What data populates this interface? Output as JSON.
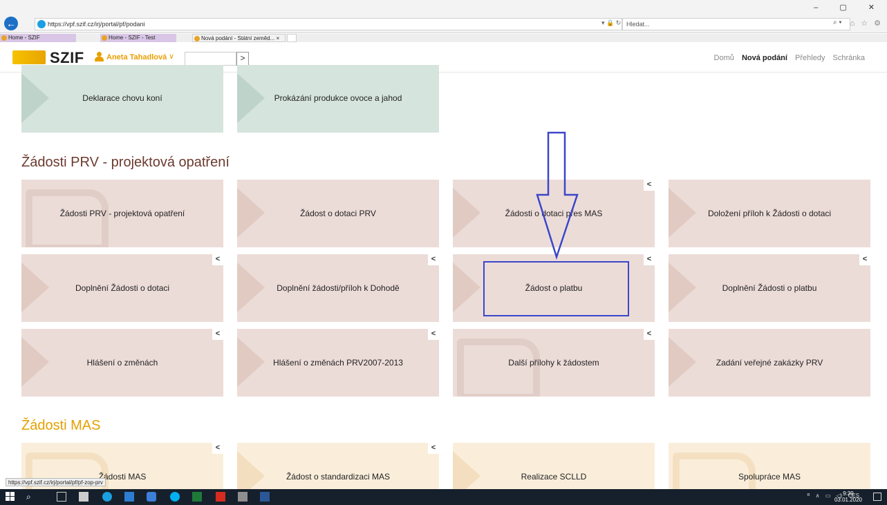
{
  "browser": {
    "url": "https://vpf.szif.cz/irj/portal/pf/podani",
    "search_placeholder": "Hledat...",
    "tabs": [
      {
        "label": "Home - SZIF"
      },
      {
        "label": "Home - SZIF - Test"
      },
      {
        "label": "Nová podání - Státní zeměd... ×"
      },
      {
        "label": ""
      }
    ],
    "status_url": "https://vpf.szif.cz/irj/portal/pf/pf-zop-prv"
  },
  "header": {
    "logo": "SZIF",
    "user_name": "Aneta Tahadlová",
    "user_caret": "∨",
    "search_btn": ">",
    "nav": [
      {
        "label": "Domů"
      },
      {
        "label": "Nová podání",
        "active": true
      },
      {
        "label": "Přehledy"
      },
      {
        "label": "Schránka"
      }
    ]
  },
  "tiles_top": [
    {
      "label": "Deklarace chovu koní"
    },
    {
      "label": "Prokázání produkce ovoce a jahod"
    }
  ],
  "section_prv": {
    "title": "Žádosti PRV - projektová opatření",
    "tiles": [
      {
        "label": "Žádosti PRV - projektová opatření"
      },
      {
        "label": "Žádost o dotaci PRV"
      },
      {
        "label": "Žádosti o dotaci přes MAS",
        "flag": "<"
      },
      {
        "label": "Doložení příloh k Žádosti o dotaci"
      },
      {
        "label": "Doplnění Žádosti o dotaci",
        "flag": "<"
      },
      {
        "label": "Doplnění žádosti/příloh k Dohodě",
        "flag": "<"
      },
      {
        "label": "Žádost o platbu",
        "flag": "<"
      },
      {
        "label": "Doplnění Žádosti o platbu",
        "flag": "<"
      },
      {
        "label": "Hlášení o změnách",
        "flag": "<"
      },
      {
        "label": "Hlášení o změnách PRV2007-2013",
        "flag": "<"
      },
      {
        "label": "Další přílohy k žádostem",
        "flag": "<"
      },
      {
        "label": "Zadání veřejné zakázky PRV"
      }
    ]
  },
  "section_mas": {
    "title": "Žádosti MAS",
    "tiles": [
      {
        "label": "Žádosti MAS",
        "flag": "<"
      },
      {
        "label": "Žádost o standardizaci MAS",
        "flag": "<"
      },
      {
        "label": "Realizace SCLLD"
      },
      {
        "label": "Spolupráce MAS"
      }
    ]
  },
  "taskbar": {
    "lang": "CES",
    "time": "9:39",
    "date": "03.01.2020"
  },
  "colors": {
    "brand_yellow": "#f6c200",
    "user_orange": "#e89f00",
    "tile_brown": "#ecdcd8",
    "tile_green": "#d6e4de",
    "tile_orange": "#faeedb",
    "annotation_blue": "#3a46c9"
  }
}
